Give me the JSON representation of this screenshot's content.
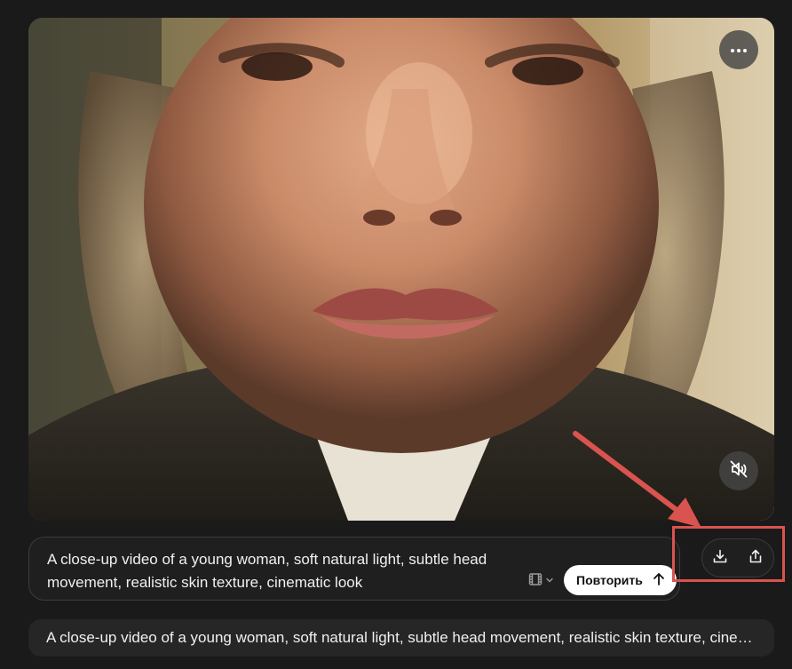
{
  "video": {
    "image": "close-up-portrait-young-woman",
    "more_icon": "more-horizontal-icon",
    "mute_icon": "volume-muted-icon"
  },
  "prompt": {
    "text": "A close-up video of a young woman, soft natural light, subtle head movement, realistic skin texture, cinematic look",
    "format_icon": "film-icon",
    "retry_label": "Повторить",
    "retry_icon": "arrow-up-icon"
  },
  "actions": {
    "download_icon": "download-icon",
    "share_icon": "share-icon"
  },
  "annotation": {
    "color": "#d9534f"
  },
  "history": {
    "item_text": "A close-up video of a young woman, soft natural light, subtle head movement, realistic skin texture, cinematic look"
  }
}
